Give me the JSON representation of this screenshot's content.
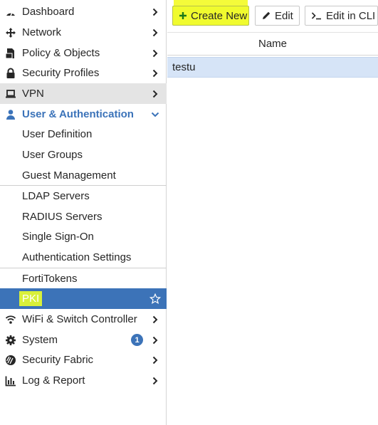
{
  "sidebar": {
    "items": [
      {
        "label": "Dashboard",
        "icon": "dashboard-icon"
      },
      {
        "label": "Network",
        "icon": "network-icon"
      },
      {
        "label": "Policy & Objects",
        "icon": "policy-icon"
      },
      {
        "label": "Security Profiles",
        "icon": "lock-icon"
      },
      {
        "label": "VPN",
        "icon": "laptop-icon"
      },
      {
        "label": "User & Authentication",
        "icon": "user-icon"
      },
      {
        "label": "User Definition"
      },
      {
        "label": "User Groups"
      },
      {
        "label": "Guest Management"
      },
      {
        "label": "LDAP Servers"
      },
      {
        "label": "RADIUS Servers"
      },
      {
        "label": "Single Sign-On"
      },
      {
        "label": "Authentication Settings"
      },
      {
        "label": "FortiTokens"
      },
      {
        "label": "PKI"
      },
      {
        "label": "WiFi & Switch Controller",
        "icon": "wifi-icon"
      },
      {
        "label": "System",
        "icon": "gear-icon",
        "badge": "1"
      },
      {
        "label": "Security Fabric",
        "icon": "fabric-icon"
      },
      {
        "label": "Log & Report",
        "icon": "chart-icon"
      }
    ]
  },
  "toolbar": {
    "create_label": "Create New",
    "edit_label": "Edit",
    "cli_label": "Edit in CLI"
  },
  "table": {
    "columns": [
      "Name"
    ],
    "rows": [
      [
        "testu"
      ]
    ]
  },
  "colors": {
    "accent": "#3c73b8",
    "highlight": "#f0fb2e",
    "selected_row": "#d6e4f7"
  }
}
